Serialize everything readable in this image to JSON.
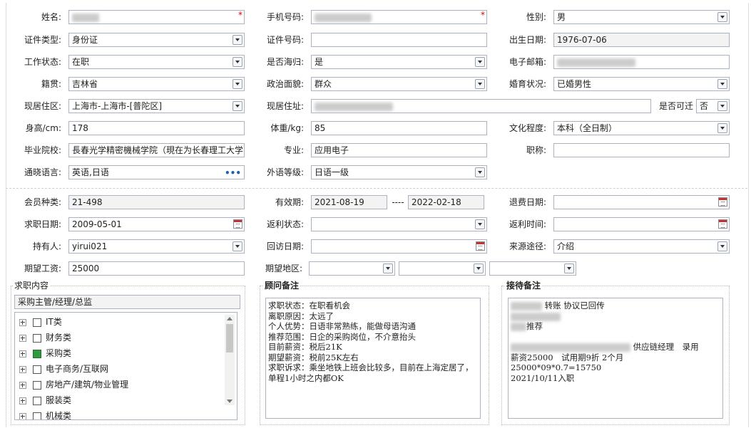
{
  "personal": {
    "name_label": "姓名:",
    "phone_label": "手机号码:",
    "gender_label": "性别:",
    "gender": "男",
    "id_type_label": "证件类型:",
    "id_type": "身份证",
    "id_no_label": "证件号码:",
    "id_no": "",
    "birth_label": "出生日期:",
    "birth": "1976-07-06",
    "work_status_label": "工作状态:",
    "work_status": "在职",
    "returnee_label": "是否海归:",
    "returnee": "是",
    "email_label": "电子邮箱:",
    "native_label": "籍贯:",
    "native": "吉林省",
    "political_label": "政治面貌:",
    "political": "群众",
    "marital_label": "婚育状况:",
    "marital": "已婚男性",
    "residence_area_label": "现居住区:",
    "residence_area": "上海市-上海市-[普陀区]",
    "address_label": "现居住址:",
    "relocate_label": "是否可迁",
    "relocate": "否",
    "height_label": "身高/cm:",
    "height": "178",
    "weight_label": "体重/kg:",
    "weight": "85",
    "education_label": "文化程度:",
    "education": "本科（全日制）",
    "school_label": "毕业院校:",
    "school": "長春光学精密機械学院（現在为长春理工大学",
    "major_label": "专业:",
    "major": "应用电子",
    "title_label": "职称:",
    "title": "",
    "language_label": "通晓语言:",
    "language": "英语,日语",
    "language_more": "•••",
    "foreign_level_label": "外语等级:",
    "foreign_level": "日语一级"
  },
  "membership": {
    "member_type_label": "会员种类:",
    "member_type": "21-498",
    "valid_label": "有效期:",
    "valid_from": "2021-08-19",
    "valid_sep": "----",
    "valid_to": "2022-02-18",
    "refund_date_label": "退费日期:",
    "refund_date": "",
    "job_date_label": "求职日期:",
    "job_date": "2009-05-01",
    "rebate_status_label": "返利状态:",
    "rebate_status": "",
    "rebate_time_label": "返利时间:",
    "rebate_time": "",
    "holder_label": "持有人:",
    "holder": "yirui021",
    "visit_date_label": "回访日期:",
    "visit_date": "",
    "source_label": "来源途径:",
    "source": "介绍",
    "salary_label": "期望工资:",
    "salary": "25000",
    "region_label": "期望地区:"
  },
  "job_content": {
    "title": "求职内容",
    "selected": "采购主管/经理/总监",
    "items": [
      {
        "label": "IT类",
        "checked": false
      },
      {
        "label": "财务类",
        "checked": false
      },
      {
        "label": "采购类",
        "checked": true
      },
      {
        "label": "电子商务/互联网",
        "checked": false
      },
      {
        "label": "房地产/建筑/物业管理",
        "checked": false
      },
      {
        "label": "服装类",
        "checked": false
      },
      {
        "label": "机械类",
        "checked": false
      }
    ]
  },
  "advisor_notes": {
    "title": "顾问备注",
    "text": "求职状态：在职看机会\n离职原因：太远了\n个人优势：日语非常熟练，能做母语沟通\n推荐范围：日企的采购岗位，不介意抬头\n目前薪资：税后21K\n期望薪资：税前25K左右\n求职诉求：乘坐地铁上班会比较多，目前在上海定居了，单程1小时之内都OK"
  },
  "reception_notes": {
    "title": "接待备注",
    "line1": "转账 协议已回传",
    "line3": "推荐",
    "line5": "供应链经理　录用",
    "line6": "薪资25000　试用期9折 2个月",
    "line7": "25000*09*0.7=15750",
    "line8": "2021/10/11入职"
  },
  "colors": {
    "required": "#dd0000",
    "checked": "#2e9c3c",
    "border": "#aab3bf"
  }
}
